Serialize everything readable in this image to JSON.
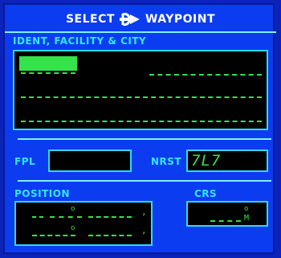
{
  "title": {
    "left": "SELECT",
    "direct_to_icon": "direct-to-arrow-icon",
    "right": "WAYPOINT"
  },
  "ident_section": {
    "label": "IDENT, FACILITY & CITY"
  },
  "fpl": {
    "label": "FPL",
    "value": ""
  },
  "nrst": {
    "label": "NRST",
    "value": "7L7"
  },
  "position": {
    "label": "POSITION"
  },
  "crs": {
    "label": "CRS",
    "unit": "M"
  },
  "colors": {
    "background": "#0b3cf0",
    "label": "#33e8ff",
    "field_text": "#35e24a"
  }
}
